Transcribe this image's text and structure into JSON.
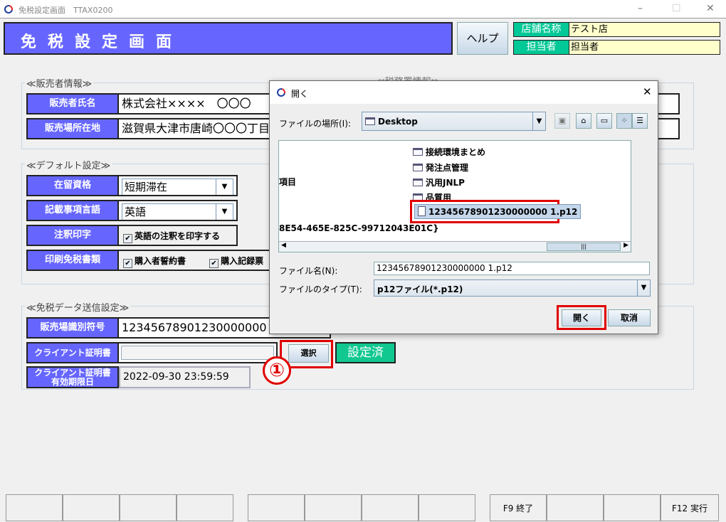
{
  "window": {
    "title": "免税設定画面　TTAX0200",
    "minimize": "–",
    "maximize": "☐",
    "close": "✕"
  },
  "header": {
    "title": "免税設定画面",
    "help": "ヘルプ",
    "store_label": "店舗名称",
    "store_value": "テスト店",
    "staff_label": "担当者",
    "staff_value": "担当者"
  },
  "seller": {
    "legend": "≪販売者情報≫",
    "name_label": "販売者氏名",
    "name_value": "株式会社××××　〇〇〇",
    "addr_label": "販売場所在地",
    "addr_value": "滋賀県大津市唐崎〇〇〇丁目",
    "tax_legend": "≪税務署情報≫"
  },
  "defaults": {
    "legend": "≪デフォルト設定≫",
    "status_label": "在留資格",
    "status_value": "短期滞在",
    "lang_label": "記載事項言語",
    "lang_value": "英語",
    "note_label": "注釈印字",
    "note_check": "英語の注釈を印字する",
    "docs_label": "印刷免税書類",
    "doc1": "購入者誓約書",
    "doc2": "購入記録票"
  },
  "send": {
    "legend": "≪免税データ送信設定≫",
    "id_label": "販売場識別符号",
    "id_value": "12345678901230000000 1",
    "cert_label": "クライアント証明書",
    "cert_value": "",
    "select": "選択",
    "status": "設定済",
    "exp_label1": "クライアント証明書",
    "exp_label2": "有効期限日",
    "exp_value": "2022-09-30 23:59:59",
    "callout": "①"
  },
  "fkeys": [
    "",
    "",
    "",
    "",
    "",
    "",
    "",
    "",
    "F9 終了",
    "",
    "",
    "F12 実行"
  ],
  "dialog": {
    "title": "開く",
    "look_in_label": "ファイルの場所(I):",
    "look_in_value": "Desktop",
    "files": [
      "接続環境まとめ",
      "発注点管理",
      "汎用JNLP",
      "品質用"
    ],
    "selected_file": "12345678901230000000 1.p12",
    "partial1": "項目",
    "partial2": "8E54-465E-825C-99712043E01C}",
    "filename_label": "ファイル名(N):",
    "filename_value": "12345678901230000000 1.p12",
    "type_label": "ファイルのタイプ(T):",
    "type_value": "p12ファイル(*.p12)",
    "open": "開く",
    "cancel": "取消"
  }
}
